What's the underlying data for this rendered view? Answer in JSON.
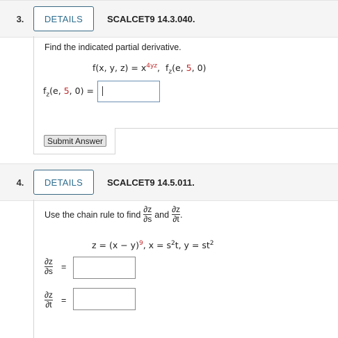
{
  "q3": {
    "number": "3.",
    "details_label": "DETAILS",
    "code": "SCALCET9 14.3.040.",
    "prompt": "Find the indicated partial derivative.",
    "func_lhs": "f(x, y, z) = x",
    "func_exp": "4yz",
    "func_sep": ",",
    "fz_f": "f",
    "fz_sub": "z",
    "fz_open": "(",
    "arg_e": "e",
    "comma1": ",",
    "arg_5": "5",
    "comma2": ",",
    "arg_0": "0",
    "fz_close": ")",
    "answer_equals": "=",
    "answer_value": "",
    "submit_label": "Submit Answer"
  },
  "q4": {
    "number": "4.",
    "details_label": "DETAILS",
    "code": "SCALCET9 14.5.011.",
    "prompt_pre": "Use the chain rule to find",
    "prompt_and": "and",
    "prompt_end": ".",
    "dz": "∂z",
    "ds": "∂s",
    "dt": "∂t",
    "eq_z": "z = (x − y)",
    "eq_z_exp": "9",
    "eq_x": ",  x = s",
    "eq_x_exp": "2",
    "eq_x_end": "t,  y = st",
    "eq_y_exp": "2",
    "ans1_equals": "=",
    "ans2_equals": "=",
    "ans1_value": "",
    "ans2_value": ""
  }
}
